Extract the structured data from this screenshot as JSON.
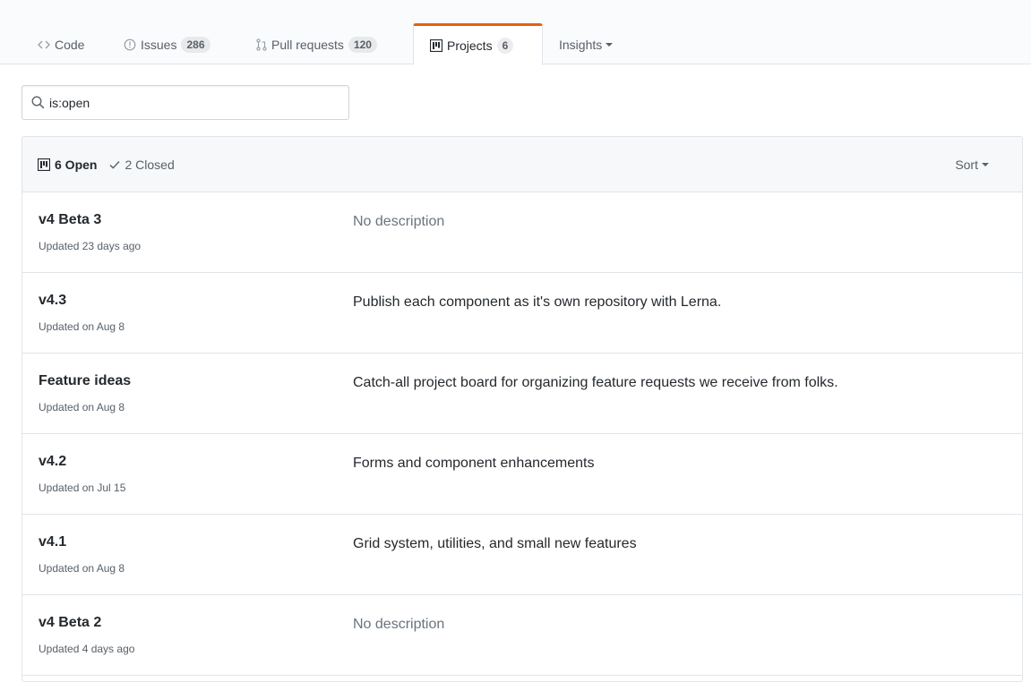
{
  "nav": {
    "tabs": [
      {
        "label": "Code",
        "icon": "code-icon"
      },
      {
        "label": "Issues",
        "count": "286",
        "icon": "issue-icon"
      },
      {
        "label": "Pull requests",
        "count": "120",
        "icon": "pull-request-icon"
      },
      {
        "label": "Projects",
        "count": "6",
        "icon": "project-icon"
      },
      {
        "label": "Insights",
        "icon": "chevron-down-icon"
      }
    ],
    "selected": "Projects",
    "accent_color": "#e36209"
  },
  "search": {
    "value": "is:open"
  },
  "list": {
    "open_label": "6 Open",
    "closed_label": "2 Closed",
    "sort_label": "Sort",
    "projects": [
      {
        "name": "v4 Beta 3",
        "updated": "Updated 23 days ago",
        "description": "No description"
      },
      {
        "name": "v4.3",
        "updated": "Updated on Aug 8",
        "description": "Publish each component as it's own repository with Lerna."
      },
      {
        "name": "Feature ideas",
        "updated": "Updated on Aug 8",
        "description": "Catch-all project board for organizing feature requests we receive from folks."
      },
      {
        "name": "v4.2",
        "updated": "Updated on Jul 15",
        "description": "Forms and component enhancements"
      },
      {
        "name": "v4.1",
        "updated": "Updated on Aug 8",
        "description": "Grid system, utilities, and small new features"
      },
      {
        "name": "v4 Beta 2",
        "updated": "Updated 4 days ago",
        "description": "No description"
      }
    ]
  }
}
